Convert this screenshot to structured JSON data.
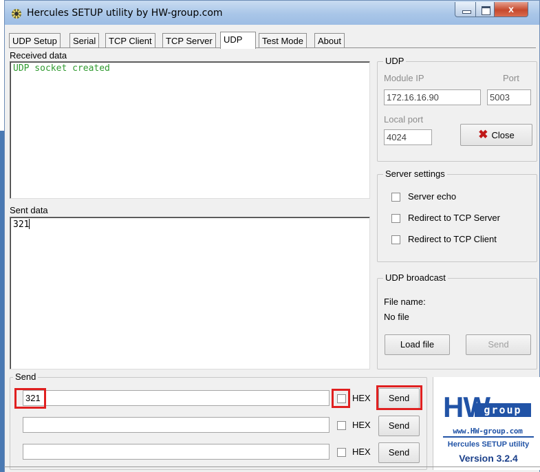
{
  "window": {
    "title": "Hercules SETUP utility by HW-group.com",
    "close_glyph": "x"
  },
  "tabs": [
    "UDP Setup",
    "Serial",
    "TCP Client",
    "TCP Server",
    "UDP",
    "Test Mode",
    "About"
  ],
  "received": {
    "label": "Received data",
    "text": "UDP socket created"
  },
  "sent": {
    "label": "Sent data",
    "text": "321"
  },
  "udp": {
    "title": "UDP",
    "module_ip_label": "Module IP",
    "module_ip": "172.16.16.90",
    "port_label": "Port",
    "port": "5003",
    "local_port_label": "Local port",
    "local_port": "4024",
    "close_button": "Close"
  },
  "server_settings": {
    "title": "Server settings",
    "options": [
      "Server echo",
      "Redirect to TCP Server",
      "Redirect to TCP Client"
    ]
  },
  "broadcast": {
    "title": "UDP broadcast",
    "file_name_label": "File name:",
    "file_name": "No file",
    "load_button": "Load file",
    "send_button": "Send"
  },
  "send": {
    "title": "Send",
    "rows": [
      {
        "value": "321",
        "hex_label": "HEX",
        "button": "Send"
      },
      {
        "value": "",
        "hex_label": "HEX",
        "button": "Send"
      },
      {
        "value": "",
        "hex_label": "HEX",
        "button": "Send"
      }
    ]
  },
  "logo": {
    "hw": "HW",
    "group": "group",
    "url": "www.HW-group.com",
    "name": "Hercules SETUP utility",
    "version": "Version  3.2.4"
  },
  "colors": {
    "received_text": "#2f9a2f",
    "highlight": "#e02020",
    "brand": "#2153a6"
  }
}
